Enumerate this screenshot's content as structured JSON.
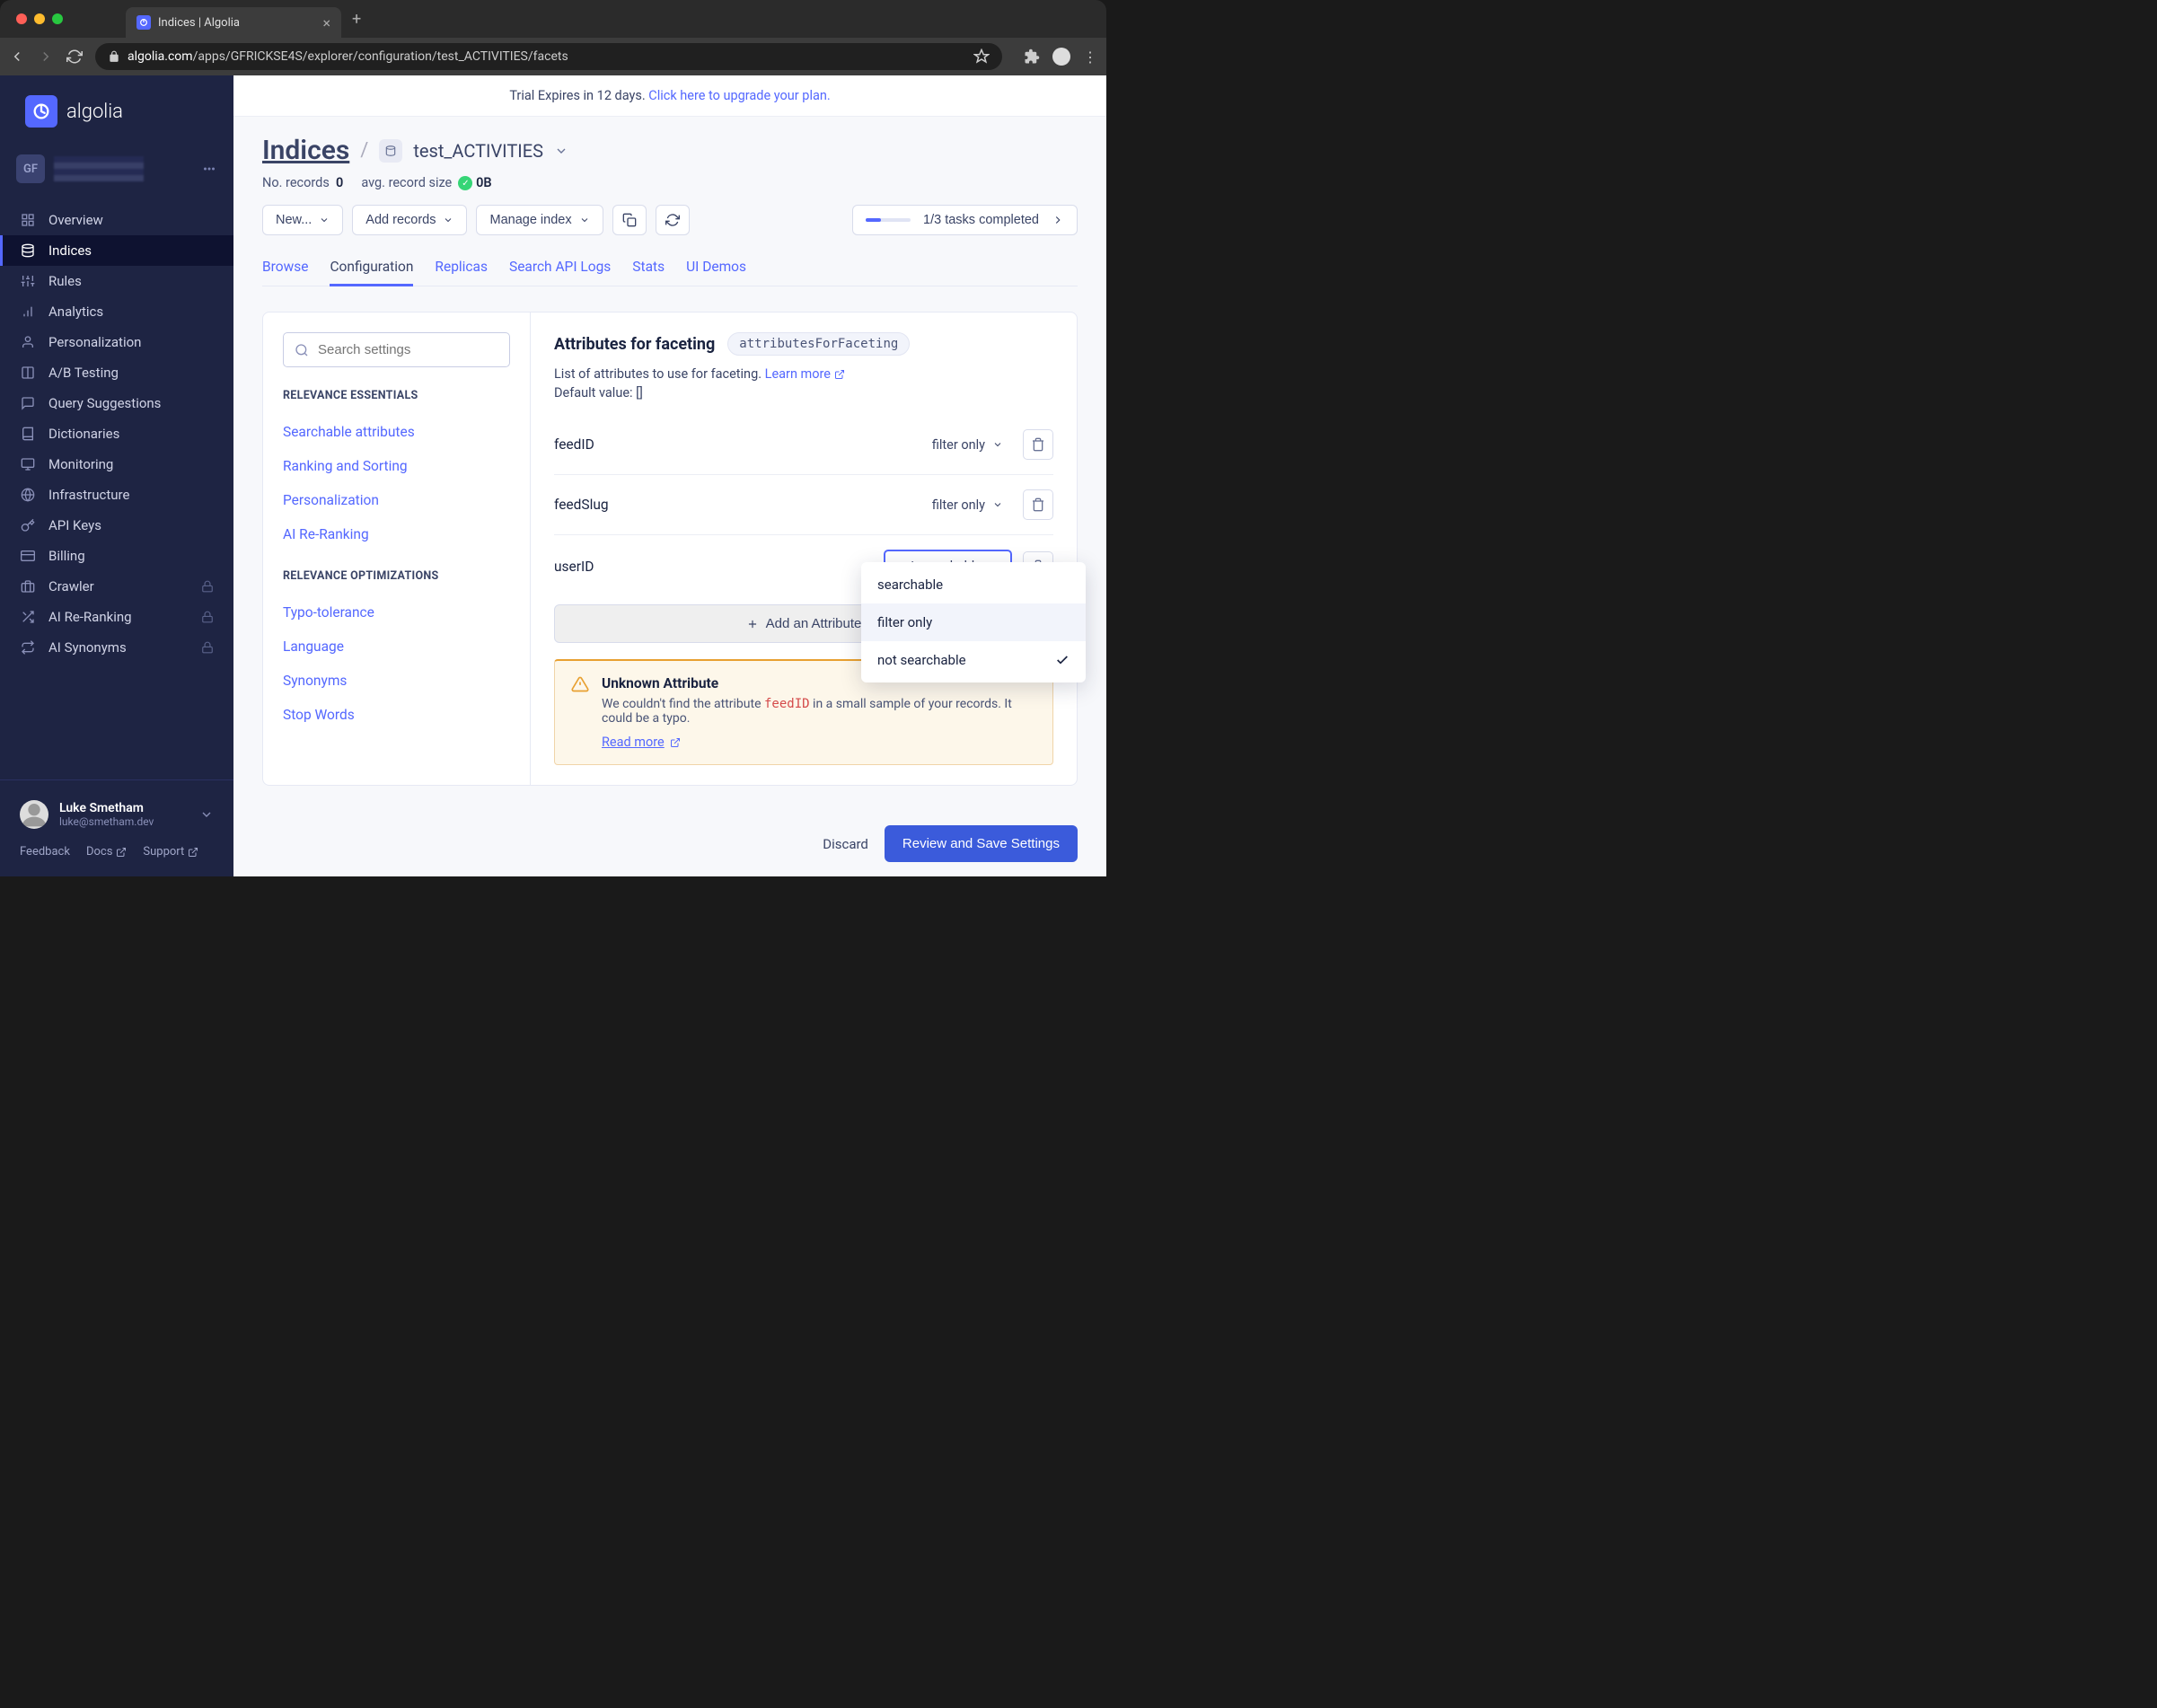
{
  "browser": {
    "tab_title": "Indices | Algolia",
    "url_prefix": "algolia.com",
    "url_path": "/apps/GFRICKSE4S/explorer/configuration/test_ACTIVITIES/facets"
  },
  "logo_text": "algolia",
  "app_badge": "GF",
  "nav": {
    "items": [
      {
        "label": "Overview",
        "icon": "grid"
      },
      {
        "label": "Indices",
        "icon": "db",
        "active": true
      },
      {
        "label": "Rules",
        "icon": "sliders"
      },
      {
        "label": "Analytics",
        "icon": "bar"
      },
      {
        "label": "Personalization",
        "icon": "person"
      },
      {
        "label": "A/B Testing",
        "icon": "ab"
      },
      {
        "label": "Query Suggestions",
        "icon": "chat"
      },
      {
        "label": "Dictionaries",
        "icon": "book"
      },
      {
        "label": "Monitoring",
        "icon": "monitor"
      },
      {
        "label": "Infrastructure",
        "icon": "globe"
      },
      {
        "label": "API Keys",
        "icon": "key"
      },
      {
        "label": "Billing",
        "icon": "card"
      },
      {
        "label": "Crawler",
        "icon": "briefcase",
        "locked": true
      },
      {
        "label": "AI Re-Ranking",
        "icon": "shuffle",
        "locked": true
      },
      {
        "label": "AI Synonyms",
        "icon": "swap",
        "locked": true
      }
    ]
  },
  "user": {
    "name": "Luke Smetham",
    "email": "luke@smetham.dev"
  },
  "footer_links": [
    "Feedback",
    "Docs",
    "Support"
  ],
  "trial": {
    "text": "Trial Expires in 12 days. ",
    "link": "Click here to upgrade your plan."
  },
  "breadcrumb": {
    "root": "Indices",
    "index": "test_ACTIVITIES"
  },
  "stats": {
    "records_label": "No. records",
    "records_value": "0",
    "avg_label": "avg. record size",
    "avg_value": "0B"
  },
  "actions": {
    "new": "New...",
    "add_records": "Add records",
    "manage": "Manage index",
    "tasks": "1/3 tasks completed"
  },
  "tabs": [
    "Browse",
    "Configuration",
    "Replicas",
    "Search API Logs",
    "Stats",
    "UI Demos"
  ],
  "active_tab": "Configuration",
  "settings_search_placeholder": "Search settings",
  "settings_sections": {
    "essentials": {
      "title": "RELEVANCE ESSENTIALS",
      "items": [
        "Searchable attributes",
        "Ranking and Sorting",
        "Personalization",
        "AI Re-Ranking"
      ]
    },
    "optimizations": {
      "title": "RELEVANCE OPTIMIZATIONS",
      "items": [
        "Typo-tolerance",
        "Language",
        "Synonyms",
        "Stop Words"
      ]
    }
  },
  "faceting": {
    "title": "Attributes for faceting",
    "code": "attributesForFaceting",
    "desc": "List of attributes to use for faceting. ",
    "learn_more": "Learn more",
    "default_label": "Default value: []",
    "attributes": [
      {
        "name": "feedID",
        "mode": "filter only"
      },
      {
        "name": "feedSlug",
        "mode": "filter only"
      },
      {
        "name": "userID",
        "mode": "not searchable",
        "open": true
      }
    ],
    "add_label": "Add an Attribute",
    "dropdown_options": [
      "searchable",
      "filter only",
      "not searchable"
    ],
    "dropdown_selected": "not searchable",
    "dropdown_highlighted": "filter only"
  },
  "warning": {
    "title": "Unknown Attribute",
    "text_before": "We couldn't find the attribute ",
    "code": "feedID",
    "text_after": " in a small sample of your records. It could be a typo.",
    "link": "Read more"
  },
  "footer_actions": {
    "discard": "Discard",
    "save": "Review and Save Settings"
  }
}
